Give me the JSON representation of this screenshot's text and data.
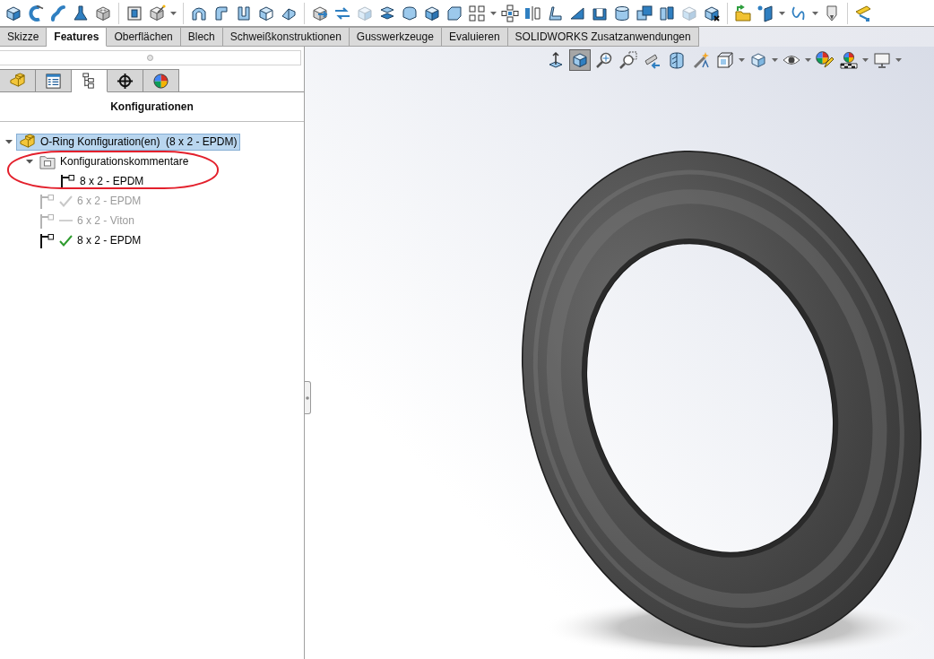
{
  "command_tabs": [
    {
      "label": "Skizze",
      "selected": false
    },
    {
      "label": "Features",
      "selected": true
    },
    {
      "label": "Oberflächen",
      "selected": false
    },
    {
      "label": "Blech",
      "selected": false
    },
    {
      "label": "Schweißkonstruktionen",
      "selected": false
    },
    {
      "label": "Gusswerkzeuge",
      "selected": false
    },
    {
      "label": "Evaluieren",
      "selected": false
    },
    {
      "label": "SOLIDWORKS Zusatzanwendungen",
      "selected": false
    }
  ],
  "panel_tabs": [
    {
      "selected": false
    },
    {
      "selected": false
    },
    {
      "selected": true
    },
    {
      "selected": false
    },
    {
      "selected": false
    }
  ],
  "panel": {
    "title": "Konfigurationen"
  },
  "tree": {
    "kind": "part",
    "label": "O-Ring Konfiguration(en)  (8 x 2 - EPDM)",
    "selected": true,
    "disabled": false,
    "expanded": true,
    "children": [
      {
        "kind": "folder",
        "label": "Konfigurationskommentare",
        "selected": false,
        "disabled": false,
        "expanded": true,
        "circled": true,
        "children": [
          {
            "kind": "comment",
            "label": "8 x 2 - EPDM",
            "selected": false,
            "disabled": false
          }
        ]
      },
      {
        "kind": "configuration",
        "label": "6 x 2 - EPDM",
        "selected": false,
        "disabled": true,
        "checked": true
      },
      {
        "kind": "configuration",
        "label": "6 x 2 - Viton",
        "selected": false,
        "disabled": true,
        "checked": false
      },
      {
        "kind": "configuration",
        "label": "8 x 2 - EPDM",
        "selected": false,
        "disabled": false,
        "checked": true
      }
    ]
  },
  "view_tools": [
    {
      "selected": false
    },
    {
      "selected": true
    },
    {
      "selected": false
    },
    {
      "selected": false
    },
    {
      "selected": false
    },
    {
      "selected": false
    },
    {
      "selected": false
    },
    {
      "selected": false
    },
    {
      "selected": false
    },
    {
      "selected": false
    },
    {
      "selected": false
    },
    {
      "selected": false
    },
    {
      "selected": false
    }
  ]
}
